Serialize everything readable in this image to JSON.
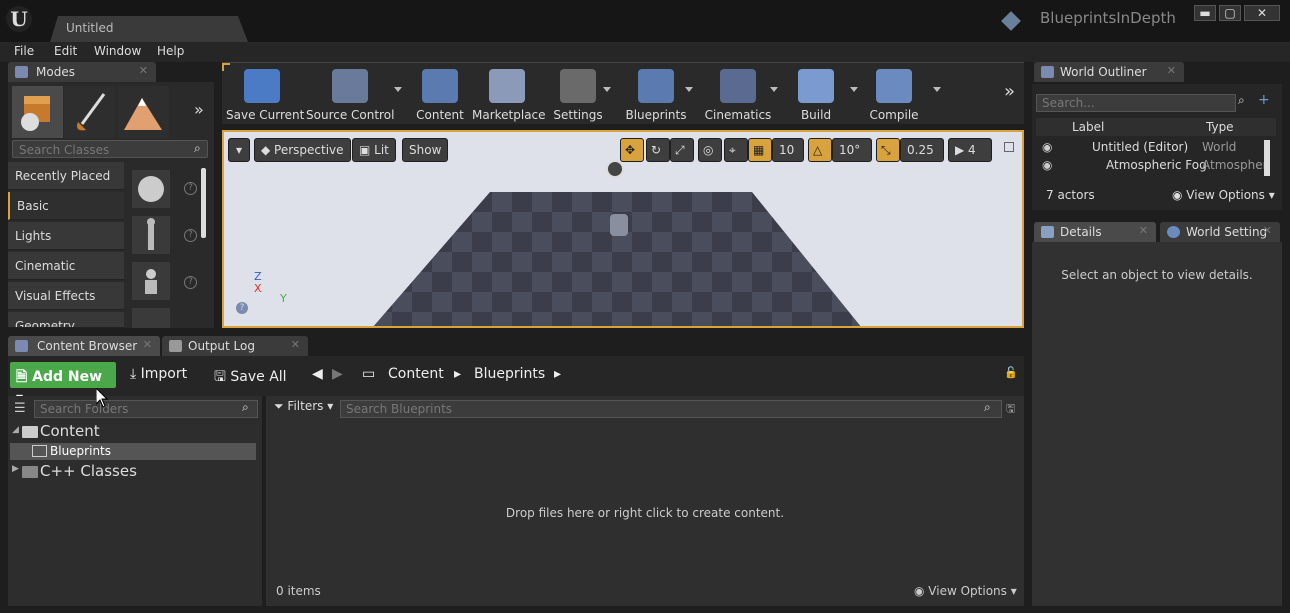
{
  "app": {
    "document_tab": "Untitled",
    "project_name": "BlueprintsInDepth"
  },
  "window_buttons": {
    "minimize": "▬",
    "maximize": "▢",
    "close": "✕"
  },
  "menu": [
    "File",
    "Edit",
    "Window",
    "Help"
  ],
  "modes": {
    "tab_title": "Modes",
    "search_placeholder": "Search Classes",
    "categories": [
      "Recently Placed",
      "Basic",
      "Lights",
      "Cinematic",
      "Visual Effects",
      "Geometry"
    ],
    "selected_category": "Basic"
  },
  "toolbar": {
    "buttons": [
      "Save Current",
      "Source Control",
      "Content",
      "Marketplace",
      "Settings",
      "Blueprints",
      "Cinematics",
      "Build",
      "Compile"
    ]
  },
  "viewport": {
    "perspective": "Perspective",
    "lit": "Lit",
    "show": "Show",
    "grid_snap": "10",
    "rotation_snap": "10°",
    "scale_snap": "0.25",
    "camera_speed": "4",
    "axis_z": "Z",
    "axis_x": "X",
    "axis_y": "Y"
  },
  "outliner": {
    "tab_title": "World Outliner",
    "search_placeholder": "Search...",
    "col_label": "Label",
    "col_type": "Type",
    "rows": [
      {
        "label": "Untitled (Editor)",
        "type": "World"
      },
      {
        "label": "Atmospheric Fog",
        "type": "Atmospher"
      }
    ],
    "actor_count": "7 actors",
    "view_options": "View Options"
  },
  "details": {
    "tab_title": "Details",
    "world_settings_tab": "World Setting",
    "empty_message": "Select an object to view details."
  },
  "content_browser": {
    "tab_title": "Content Browser",
    "output_log_tab": "Output Log",
    "add_new": "Add New",
    "import": "Import",
    "save_all": "Save All",
    "path": [
      "Content",
      "Blueprints"
    ],
    "folder_search_placeholder": "Search Folders",
    "filters": "Filters",
    "asset_search_placeholder": "Search Blueprints",
    "folders": {
      "root": "Content",
      "child": "Blueprints",
      "cpp": "C++ Classes"
    },
    "drop_hint": "Drop files here or right click to create content.",
    "item_count": "0 items",
    "view_options": "View Options"
  }
}
